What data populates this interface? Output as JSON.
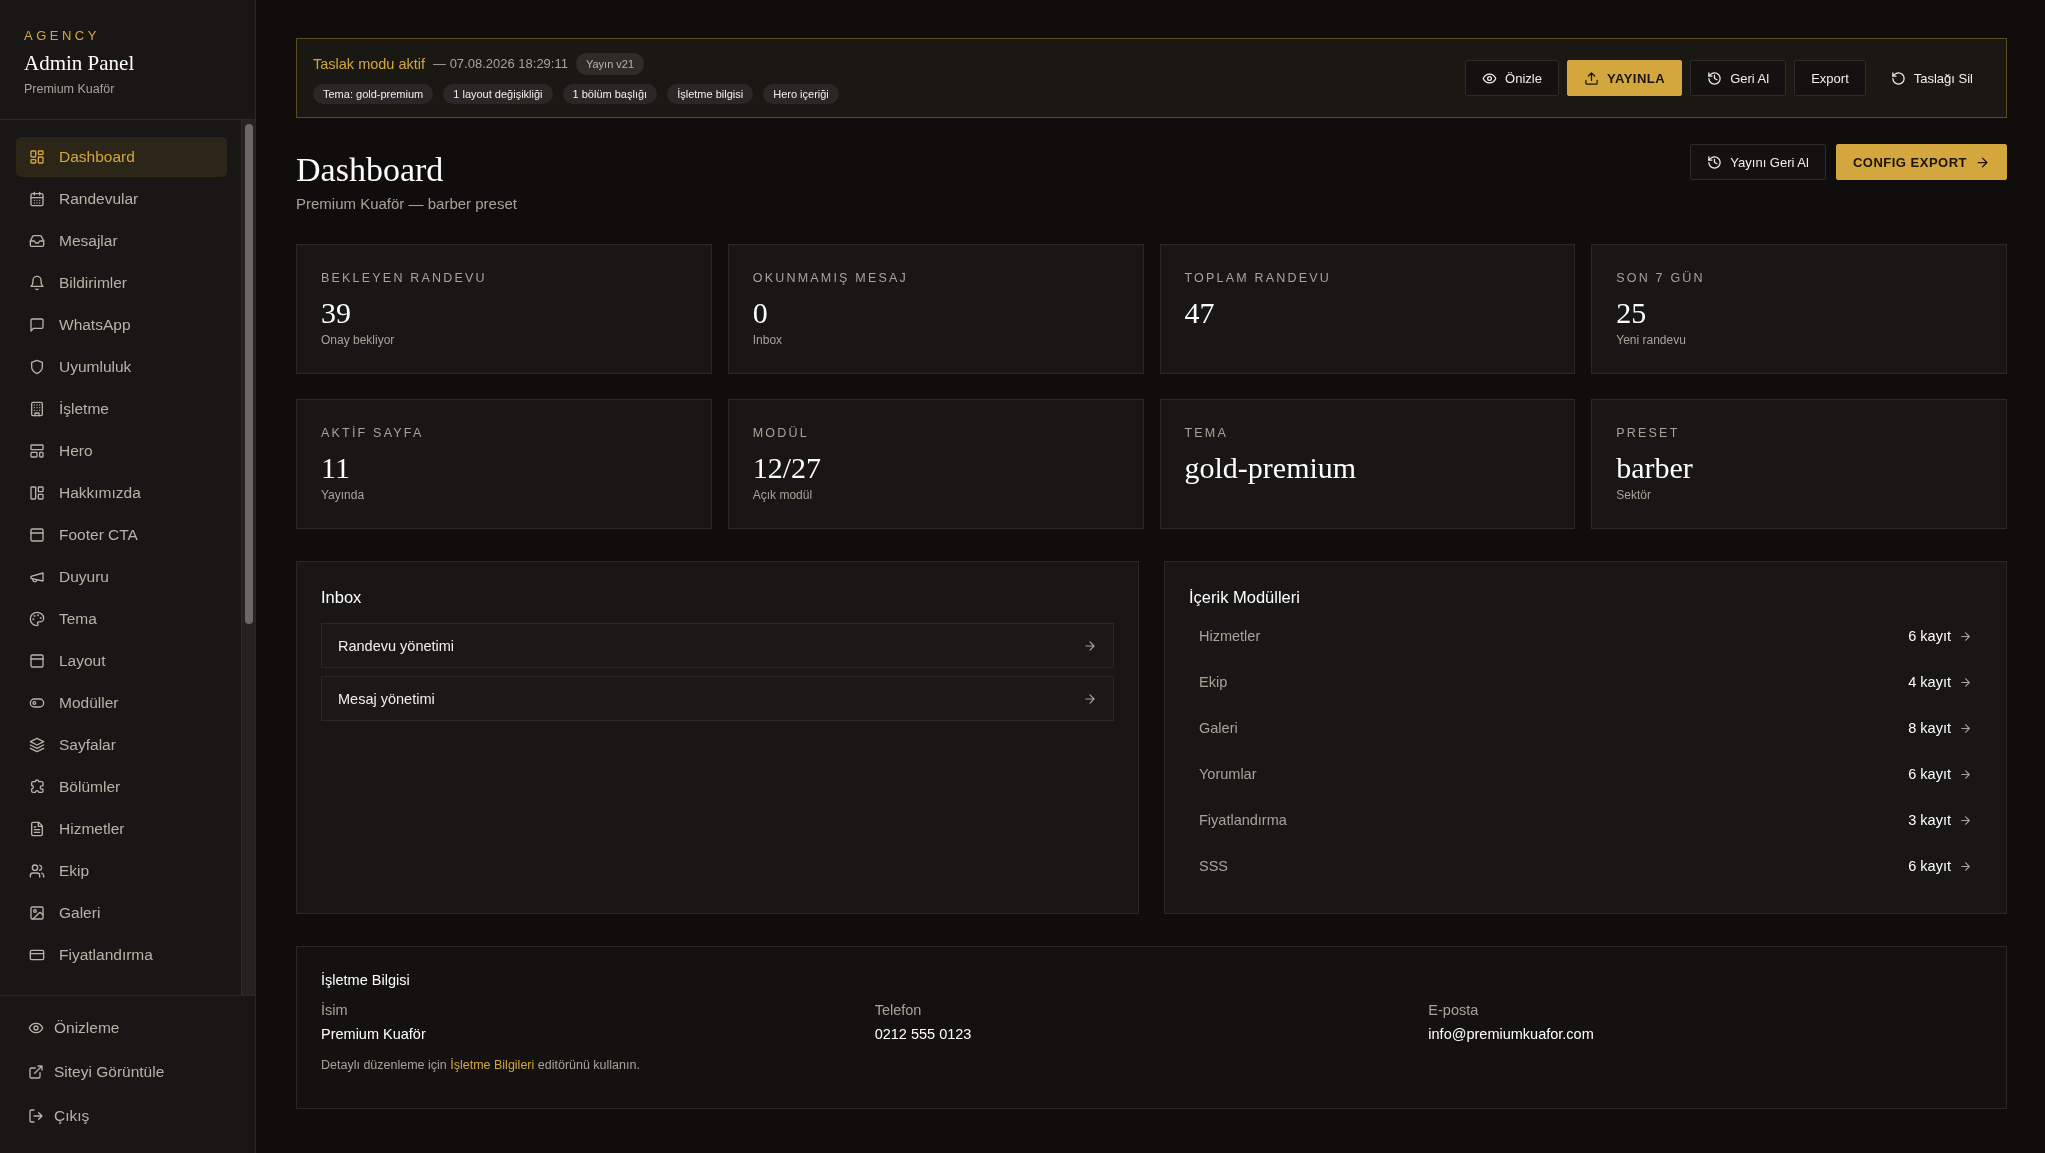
{
  "sidebar": {
    "brand_tag": "AGENCY",
    "title": "Admin Panel",
    "subtitle": "Premium Kuaför",
    "items": [
      {
        "label": "Dashboard",
        "selected": true
      },
      {
        "label": "Randevular",
        "selected": false
      },
      {
        "label": "Mesajlar",
        "selected": false
      },
      {
        "label": "Bildirimler",
        "selected": false
      },
      {
        "label": "WhatsApp",
        "selected": false
      },
      {
        "label": "Uyumluluk",
        "selected": false
      },
      {
        "label": "İşletme",
        "selected": false
      },
      {
        "label": "Hero",
        "selected": false
      },
      {
        "label": "Hakkımızda",
        "selected": false
      },
      {
        "label": "Footer CTA",
        "selected": false
      },
      {
        "label": "Duyuru",
        "selected": false
      },
      {
        "label": "Tema",
        "selected": false
      },
      {
        "label": "Layout",
        "selected": false
      },
      {
        "label": "Modüller",
        "selected": false
      },
      {
        "label": "Sayfalar",
        "selected": false
      },
      {
        "label": "Bölümler",
        "selected": false
      },
      {
        "label": "Hizmetler",
        "selected": false
      },
      {
        "label": "Ekip",
        "selected": false
      },
      {
        "label": "Galeri",
        "selected": false
      },
      {
        "label": "Fiyatlandırma",
        "selected": false
      }
    ],
    "footer_items": [
      "Önizleme",
      "Siteyi Görüntüle",
      "Çıkış"
    ]
  },
  "draft_banner": {
    "title": "Taslak modu aktif",
    "timestamp": "— 07.08.2026 18:29:11",
    "version": "Yayın v21",
    "tags": [
      "Tema: gold-premium",
      "1 layout değişikliği",
      "1 bölüm başlığı",
      "İşletme bilgisi",
      "Hero içeriği"
    ],
    "actions": [
      {
        "label": "Önizle",
        "kind": "outline"
      },
      {
        "label": "YAYINLA",
        "kind": "primary"
      },
      {
        "label": "Geri Al",
        "kind": "outline"
      },
      {
        "label": "Export",
        "kind": "outline"
      },
      {
        "label": "Taslağı Sil",
        "kind": "plain"
      }
    ]
  },
  "header": {
    "title": "Dashboard",
    "subtitle": "Premium Kuaför — barber preset",
    "actions": [
      {
        "label": "Yayını Geri Al",
        "kind": "outline"
      },
      {
        "label": "CONFIG EXPORT",
        "kind": "primary"
      }
    ]
  },
  "stats": [
    {
      "label": "BEKLEYEN RANDEVU",
      "value": "39",
      "note": "Onay bekliyor"
    },
    {
      "label": "OKUNMAMIŞ MESAJ",
      "value": "0",
      "note": "Inbox"
    },
    {
      "label": "TOPLAM RANDEVU",
      "value": "47"
    },
    {
      "label": "SON 7 GÜN",
      "value": "25",
      "note": "Yeni randevu"
    },
    {
      "label": "AKTİF SAYFA",
      "value": "11",
      "note": "Yayında"
    },
    {
      "label": "MODÜL",
      "value": "12/27",
      "note": "Açık modül"
    },
    {
      "label": "TEMA",
      "value": "gold-premium"
    },
    {
      "label": "PRESET",
      "value": "barber",
      "note": "Sektör"
    }
  ],
  "inbox": {
    "title": "Inbox",
    "items": [
      "Randevu yönetimi",
      "Mesaj yönetimi"
    ]
  },
  "modules": {
    "title": "İçerik Modülleri",
    "rows": [
      {
        "name": "Hizmetler",
        "count": "6 kayıt"
      },
      {
        "name": "Ekip",
        "count": "4 kayıt"
      },
      {
        "name": "Galeri",
        "count": "8 kayıt"
      },
      {
        "name": "Yorumlar",
        "count": "6 kayıt"
      },
      {
        "name": "Fiyatlandırma",
        "count": "3 kayıt"
      },
      {
        "name": "SSS",
        "count": "6 kayıt"
      }
    ]
  },
  "business": {
    "title": "İşletme Bilgisi",
    "fields": [
      {
        "label": "İsim",
        "value": "Premium Kuaför"
      },
      {
        "label": "Telefon",
        "value": "0212 555 0123"
      },
      {
        "label": "E-posta",
        "value": "info@premiumkuafor.com"
      }
    ],
    "note": {
      "before": "Detaylı düzenleme için",
      "link": "İşletme Bilgileri",
      "after": "editörünü kullanın."
    }
  }
}
